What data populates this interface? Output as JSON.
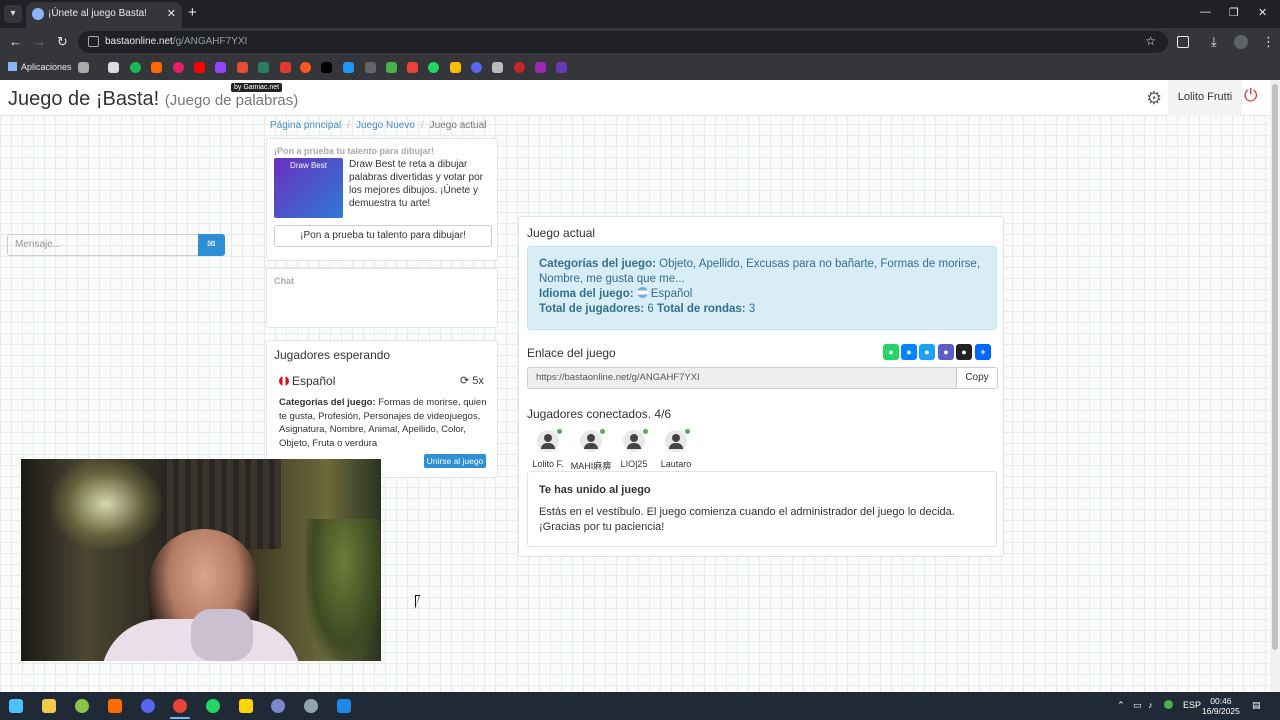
{
  "browser": {
    "tab_title": "¡Únete al juego Basta!",
    "url_host": "bastaonline.net",
    "url_path": "/g/ANGAHF7YXI",
    "bookmarks_apps_label": "Aplicaciones"
  },
  "header": {
    "title": "Juego de ¡Basta!",
    "subtitle": "(Juego de palabras)",
    "badge": "by Gamiac.net",
    "user": "Lolito Frutti"
  },
  "breadcrumb": [
    "Página principal",
    "Juego Nuevo",
    "Juego actual"
  ],
  "promo": {
    "title": "¡Pon a prueba tu talento para dibujar!",
    "image_label": "Draw Best",
    "text": "Draw Best te reta a dibujar palabras divertidas y votar por los mejores dibujos. ¡Únete y demuestra tu arte!",
    "button": "¡Pon a prueba tu talento para dibujar!"
  },
  "chat": {
    "title": "Chat",
    "placeholder": "Mensaje..."
  },
  "waiting": {
    "title": "Jugadores esperando",
    "language": "Español",
    "count": "5x",
    "categories_label": "Categorías del juego:",
    "categories": "Formas de morirse, quien te gusta, Profesión, Personajes de videojuegos, Asignatura, Nombre, Animal, Apellido, Color, Objeto, Fruta o verdura",
    "join_button": "Unirse al juego"
  },
  "game": {
    "title": "Juego actual",
    "categories_label": "Categorías del juego:",
    "categories": "Objeto, Apellido, Excusas para no bañarte, Formas de morirse, Nombre, me gusta que me...",
    "language_label": "Idioma del juego:",
    "language": "Español",
    "players_label": "Total de jugadores:",
    "players": "6",
    "rounds_label": "Total de rondas:",
    "rounds": "3",
    "link_label": "Enlace del juego",
    "link": "https://bastaonline.net/g/ANGAHF7YXI",
    "copy_button": "Copy",
    "connected_label": "Jugadores conectados. 4/6",
    "players_list": [
      "Lolito F.",
      "MAHI麻痹",
      "LIO|25",
      "Lautaro"
    ],
    "joined_title": "Te has unido al juego",
    "joined_text": "Estás en el vestíbulo. El juego comienza cuando el administrador del juego lo decida. ¡Gracias por tu paciencia!"
  },
  "taskbar": {
    "language": "ESP",
    "time": "00:46",
    "date": "16/9/2025"
  },
  "colors": {
    "primary": "#2e8ed6",
    "info_bg": "#d9edf7",
    "info_text": "#31708f",
    "power": "#d9352b",
    "online": "#4caf50"
  }
}
